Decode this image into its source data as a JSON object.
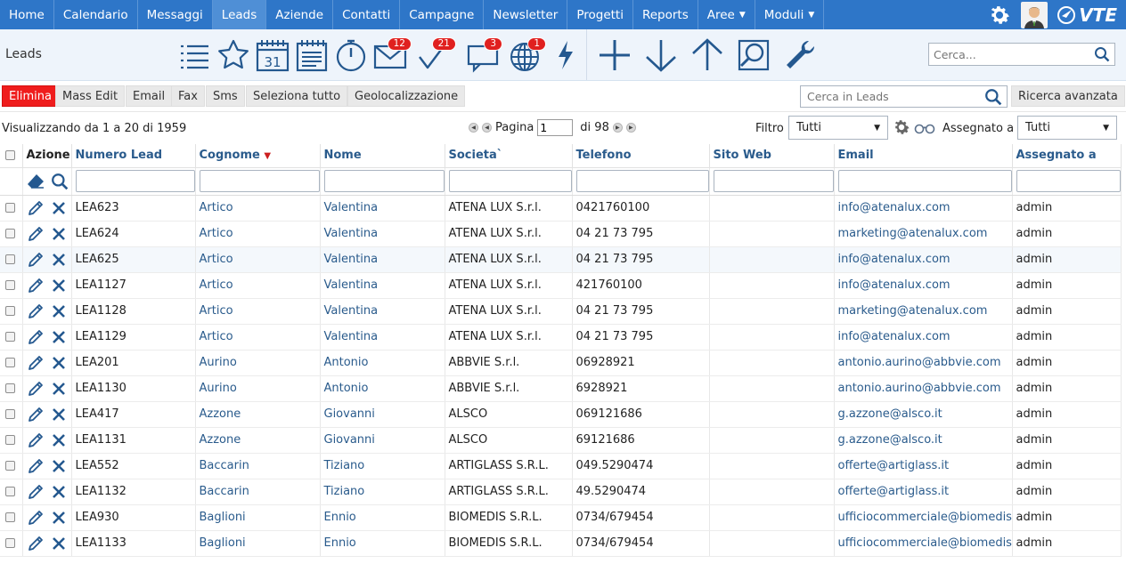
{
  "nav": {
    "items": [
      {
        "label": "Home",
        "active": false,
        "dropdown": false
      },
      {
        "label": "Calendario",
        "active": false,
        "dropdown": false
      },
      {
        "label": "Messaggi",
        "active": false,
        "dropdown": false
      },
      {
        "label": "Leads",
        "active": true,
        "dropdown": false
      },
      {
        "label": "Aziende",
        "active": false,
        "dropdown": false
      },
      {
        "label": "Contatti",
        "active": false,
        "dropdown": false
      },
      {
        "label": "Campagne",
        "active": false,
        "dropdown": false
      },
      {
        "label": "Newsletter",
        "active": false,
        "dropdown": false
      },
      {
        "label": "Progetti",
        "active": false,
        "dropdown": false
      },
      {
        "label": "Reports",
        "active": false,
        "dropdown": false
      },
      {
        "label": "Aree",
        "active": false,
        "dropdown": true
      },
      {
        "label": "Moduli",
        "active": false,
        "dropdown": true
      }
    ],
    "logo_text": "VTE"
  },
  "toolbar": {
    "module_title": "Leads",
    "calendar_day": "31",
    "badges": {
      "email": "12",
      "tasks": "21",
      "chat": "3",
      "web": "1"
    },
    "search_placeholder": "Cerca..."
  },
  "actions": {
    "buttons": [
      "Elimina",
      "Mass Edit",
      "Email",
      "Fax",
      "Sms",
      "Seleziona tutto",
      "Geolocalizzazione"
    ],
    "search_placeholder": "Cerca in Leads",
    "advanced_search": "Ricerca avanzata"
  },
  "listinfo": {
    "showing": "Visualizzando da 1 a 20 di 1959",
    "page_label": "Pagina",
    "page_value": "1",
    "page_of": "di 98",
    "filter_label": "Filtro",
    "filter_value": "Tutti",
    "assigned_label": "Assegnato a",
    "assigned_value": "Tutti"
  },
  "colors": {
    "nav_bg": "#2e76c8",
    "nav_active": "#4f8fd6",
    "accent_red": "#ef1d1d",
    "link": "#2a5b8c",
    "icon_blue": "#24588f"
  },
  "table": {
    "headers": {
      "azione": "Azione",
      "numero": "Numero Lead",
      "cognome": "Cognome",
      "nome": "Nome",
      "societa": "Societa`",
      "telefono": "Telefono",
      "sito": "Sito Web",
      "email": "Email",
      "assegnato": "Assegnato a"
    },
    "sort_column": "cognome",
    "rows": [
      {
        "numero": "LEA623",
        "cognome": "Artico",
        "nome": "Valentina",
        "societa": "ATENA LUX S.r.l.",
        "telefono": "0421760100",
        "sito": "",
        "email": "info@atenalux.com",
        "assegnato": "admin"
      },
      {
        "numero": "LEA624",
        "cognome": "Artico",
        "nome": "Valentina",
        "societa": "ATENA LUX S.r.l.",
        "telefono": "04 21 73 795",
        "sito": "",
        "email": "marketing@atenalux.com",
        "assegnato": "admin"
      },
      {
        "numero": "LEA625",
        "cognome": "Artico",
        "nome": "Valentina",
        "societa": "ATENA LUX S.r.l.",
        "telefono": "04 21 73 795",
        "sito": "",
        "email": "info@atenalux.com",
        "assegnato": "admin"
      },
      {
        "numero": "LEA1127",
        "cognome": "Artico",
        "nome": "Valentina",
        "societa": "ATENA LUX S.r.l.",
        "telefono": "421760100",
        "sito": "",
        "email": "info@atenalux.com",
        "assegnato": "admin"
      },
      {
        "numero": "LEA1128",
        "cognome": "Artico",
        "nome": "Valentina",
        "societa": "ATENA LUX S.r.l.",
        "telefono": "04 21 73 795",
        "sito": "",
        "email": "marketing@atenalux.com",
        "assegnato": "admin"
      },
      {
        "numero": "LEA1129",
        "cognome": "Artico",
        "nome": "Valentina",
        "societa": "ATENA LUX S.r.l.",
        "telefono": "04 21 73 795",
        "sito": "",
        "email": "info@atenalux.com",
        "assegnato": "admin"
      },
      {
        "numero": "LEA201",
        "cognome": "Aurino",
        "nome": "Antonio",
        "societa": "ABBVIE S.r.l.",
        "telefono": "06928921",
        "sito": "",
        "email": "antonio.aurino@abbvie.com",
        "assegnato": "admin"
      },
      {
        "numero": "LEA1130",
        "cognome": "Aurino",
        "nome": "Antonio",
        "societa": "ABBVIE S.r.l.",
        "telefono": "6928921",
        "sito": "",
        "email": "antonio.aurino@abbvie.com",
        "assegnato": "admin"
      },
      {
        "numero": "LEA417",
        "cognome": "Azzone",
        "nome": "Giovanni",
        "societa": "ALSCO",
        "telefono": "069121686",
        "sito": "",
        "email": "g.azzone@alsco.it",
        "assegnato": "admin"
      },
      {
        "numero": "LEA1131",
        "cognome": "Azzone",
        "nome": "Giovanni",
        "societa": "ALSCO",
        "telefono": "69121686",
        "sito": "",
        "email": "g.azzone@alsco.it",
        "assegnato": "admin"
      },
      {
        "numero": "LEA552",
        "cognome": "Baccarin",
        "nome": "Tiziano",
        "societa": "ARTIGLASS S.R.L.",
        "telefono": "049.5290474",
        "sito": "",
        "email": "offerte@artiglass.it",
        "assegnato": "admin"
      },
      {
        "numero": "LEA1132",
        "cognome": "Baccarin",
        "nome": "Tiziano",
        "societa": "ARTIGLASS S.R.L.",
        "telefono": "49.5290474",
        "sito": "",
        "email": "offerte@artiglass.it",
        "assegnato": "admin"
      },
      {
        "numero": "LEA930",
        "cognome": "Baglioni",
        "nome": "Ennio",
        "societa": "BIOMEDIS S.R.L.",
        "telefono": "0734/679454",
        "sito": "",
        "email": "ufficiocommerciale@biomedis.it",
        "assegnato": "admin"
      },
      {
        "numero": "LEA1133",
        "cognome": "Baglioni",
        "nome": "Ennio",
        "societa": "BIOMEDIS S.R.L.",
        "telefono": "0734/679454",
        "sito": "",
        "email": "ufficiocommerciale@biomedis.it",
        "assegnato": "admin"
      }
    ]
  }
}
